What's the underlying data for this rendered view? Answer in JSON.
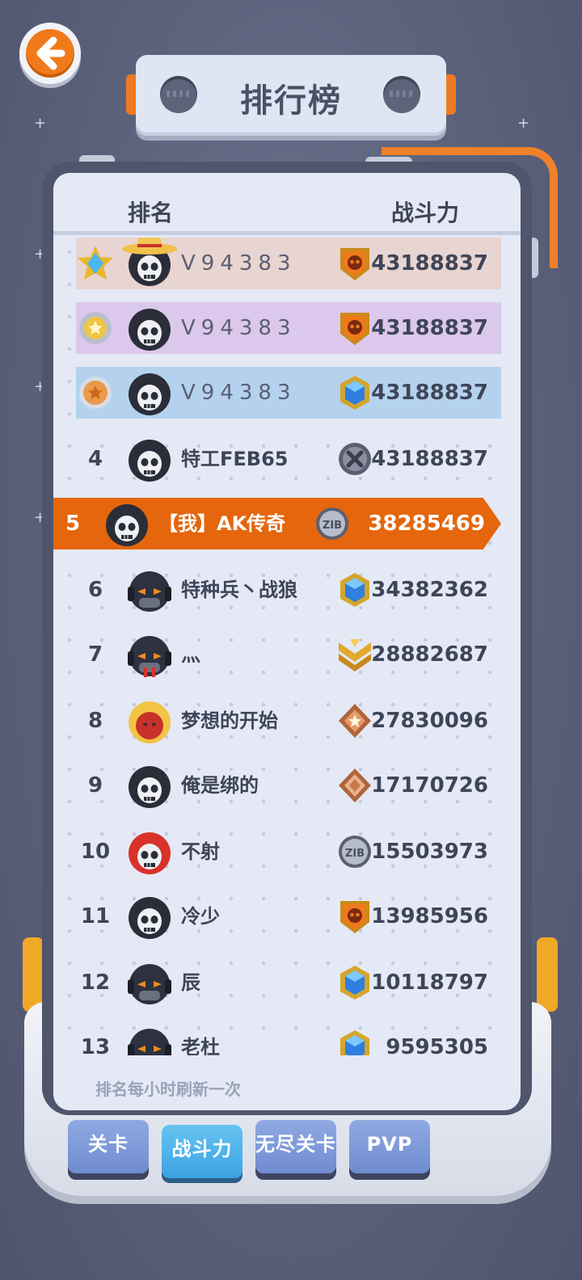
{
  "title": "排行榜",
  "header": {
    "rank_col": "排名",
    "power_col": "战斗力"
  },
  "rows": [
    {
      "rank": "",
      "medal": "star-gem",
      "avatar": "skull-straw-hat",
      "name": "V94383",
      "badge": "orange-skull-shield",
      "power": "43188837",
      "style": "gold"
    },
    {
      "rank": "",
      "medal": "gold-star",
      "avatar": "skull-hood",
      "name": "V94383",
      "badge": "orange-skull-shield",
      "power": "43188837",
      "style": "silver"
    },
    {
      "rank": "",
      "medal": "bronze-star",
      "avatar": "skull-hood",
      "name": "V94383",
      "badge": "blue-crystal-shield",
      "power": "43188837",
      "style": "bronze"
    },
    {
      "rank": "4",
      "avatar": "skull-hood",
      "name": "特工FEB65",
      "badge": "grey-cross-coin",
      "power": "43188837",
      "style": ""
    },
    {
      "rank": "5",
      "avatar": "skull-hood",
      "name": "【我】AK传奇",
      "badge": "zib-coin",
      "power": "38285469",
      "style": "me"
    },
    {
      "rank": "6",
      "avatar": "robot-headphones",
      "name": "特种兵丶战狼",
      "badge": "blue-crystal-shield",
      "power": "34382362",
      "style": ""
    },
    {
      "rank": "7",
      "avatar": "robot-headphones-red",
      "name": "灬",
      "badge": "gold-chevron",
      "power": "28882687",
      "style": ""
    },
    {
      "rank": "8",
      "avatar": "yellow-red-mask",
      "name": "梦想的开始",
      "badge": "bronze-star-shield",
      "power": "27830096",
      "style": ""
    },
    {
      "rank": "9",
      "avatar": "skull-hood",
      "name": "俺是绑的",
      "badge": "bronze-diamond",
      "power": "17170726",
      "style": ""
    },
    {
      "rank": "10",
      "avatar": "skull-red-helmet",
      "name": "不射",
      "badge": "zib-coin",
      "power": "15503973",
      "style": ""
    },
    {
      "rank": "11",
      "avatar": "skull-hood",
      "name": "冷少",
      "badge": "orange-skull-shield",
      "power": "13985956",
      "style": ""
    },
    {
      "rank": "12",
      "avatar": "robot-headphones",
      "name": "辰",
      "badge": "blue-crystal-shield-small",
      "power": "10118797",
      "style": ""
    },
    {
      "rank": "13",
      "avatar": "robot-headphones",
      "name": "老杜",
      "badge": "blue-crystal-shield",
      "power": "9595305",
      "style": ""
    }
  ],
  "footer_note": "排名每小时刷新一次",
  "tabs": [
    {
      "label": "关卡",
      "active": false
    },
    {
      "label": "战斗力",
      "active": true
    },
    {
      "label": "无尽关卡",
      "active": false
    },
    {
      "label": "PVP",
      "active": false
    }
  ],
  "colors": {
    "accent_orange": "#e5660c",
    "board": "#4f566c",
    "panel": "#e4e9f5",
    "tab_blue": "#6f8cd0",
    "tab_active": "#3ba2e2"
  }
}
